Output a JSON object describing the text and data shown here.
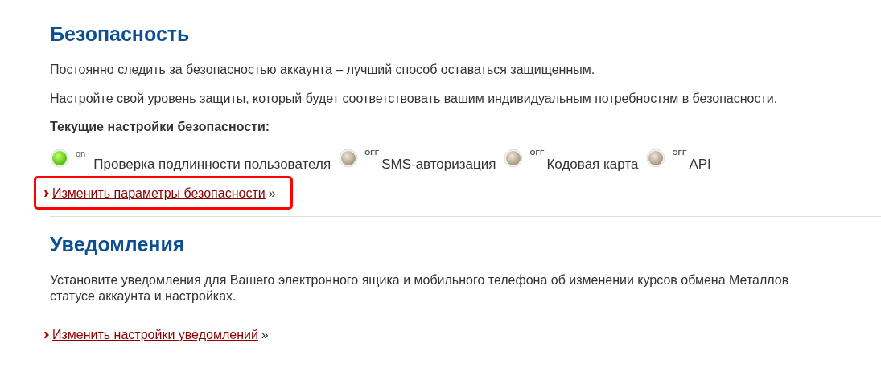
{
  "sections": [
    {
      "title": "Безопасность",
      "paragraphs": [
        [
          "Постоянно следить за безопасностью аккаунта – лучший способ оставаться защищенным."
        ],
        [
          "Настройте свой уровень защиты, который будет соответствовать вашим индивидуальным потребностям в безопасности."
        ]
      ],
      "subheading": "Текущие настройки безопасности:",
      "statuses": [
        {
          "on": true,
          "state_label": "on",
          "label": "Проверка подлинности пользователя"
        },
        {
          "on": false,
          "state_label": "OFF",
          "label": "SMS-авторизация"
        },
        {
          "on": false,
          "state_label": "OFF",
          "label": "Кодовая карта"
        },
        {
          "on": false,
          "state_label": "OFF",
          "label": "API"
        }
      ],
      "link": {
        "label": "Изменить параметры безопасности",
        "suffix": "»",
        "highlighted": true
      }
    },
    {
      "title": "Уведомления",
      "paragraphs": [
        [
          "Установите уведомления для Вашего электронного ящика и мобильного телефона об изменении курсов обмена Металлов",
          "статусе аккаунта и настройках."
        ]
      ],
      "link": {
        "label": "Изменить настройки уведомлений",
        "suffix": "»",
        "highlighted": false
      }
    }
  ]
}
